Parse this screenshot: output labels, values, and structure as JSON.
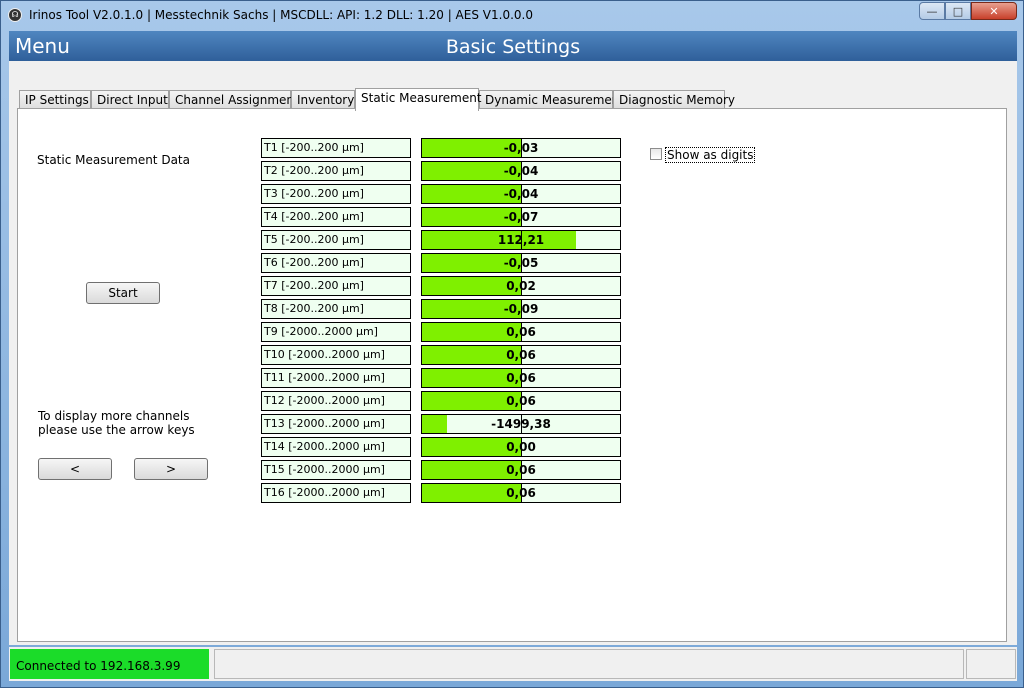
{
  "window": {
    "title": "Irinos Tool V2.0.1.0 | Messtechnik Sachs | MSCDLL: API: 1.2 DLL: 1.20 | AES V1.0.0.0",
    "buttons": {
      "minimize": "—",
      "maximize": "□",
      "close": "✕"
    }
  },
  "header": {
    "menu": "Menu",
    "title": "Basic Settings"
  },
  "tabs": [
    {
      "label": "IP Settings"
    },
    {
      "label": "Direct Input"
    },
    {
      "label": "Channel Assignment"
    },
    {
      "label": "Inventory"
    },
    {
      "label": "Static Measurement"
    },
    {
      "label": "Dynamic Measurement"
    },
    {
      "label": "Diagnostic Memory"
    }
  ],
  "static": {
    "data_label": "Static Measurement Data",
    "start_button": "Start",
    "hint_line1": "To display more channels",
    "hint_line2": "please use the arrow keys",
    "prev_button": "<",
    "next_button": ">",
    "show_digits_label": "Show as digits",
    "show_digits_checked": false
  },
  "channels": [
    {
      "label": "T1 [-200..200 µm]",
      "value": "-0,03",
      "fill_start": 0,
      "fill_end": 0.5
    },
    {
      "label": "T2 [-200..200 µm]",
      "value": "-0,04",
      "fill_start": 0,
      "fill_end": 0.5
    },
    {
      "label": "T3 [-200..200 µm]",
      "value": "-0,04",
      "fill_start": 0,
      "fill_end": 0.5
    },
    {
      "label": "T4 [-200..200 µm]",
      "value": "-0,07",
      "fill_start": 0,
      "fill_end": 0.5
    },
    {
      "label": "T5 [-200..200 µm]",
      "value": "112,21",
      "fill_start": 0,
      "fill_end": 0.78
    },
    {
      "label": "T6 [-200..200 µm]",
      "value": "-0,05",
      "fill_start": 0,
      "fill_end": 0.5
    },
    {
      "label": "T7 [-200..200 µm]",
      "value": "0,02",
      "fill_start": 0,
      "fill_end": 0.5
    },
    {
      "label": "T8 [-200..200 µm]",
      "value": "-0,09",
      "fill_start": 0,
      "fill_end": 0.5
    },
    {
      "label": "T9 [-2000..2000 µm]",
      "value": "0,06",
      "fill_start": 0,
      "fill_end": 0.5
    },
    {
      "label": "T10 [-2000..2000 µm]",
      "value": "0,06",
      "fill_start": 0,
      "fill_end": 0.5
    },
    {
      "label": "T11 [-2000..2000 µm]",
      "value": "0,06",
      "fill_start": 0,
      "fill_end": 0.5
    },
    {
      "label": "T12 [-2000..2000 µm]",
      "value": "0,06",
      "fill_start": 0,
      "fill_end": 0.5
    },
    {
      "label": "T13 [-2000..2000 µm]",
      "value": "-1499,38",
      "fill_start": 0,
      "fill_end": 0.125
    },
    {
      "label": "T14 [-2000..2000 µm]",
      "value": "0,00",
      "fill_start": 0,
      "fill_end": 0.5
    },
    {
      "label": "T15 [-2000..2000 µm]",
      "value": "0,06",
      "fill_start": 0,
      "fill_end": 0.5
    },
    {
      "label": "T16 [-2000..2000 µm]",
      "value": "0,06",
      "fill_start": 0,
      "fill_end": 0.5
    }
  ],
  "status": {
    "connection": "Connected to 192.168.3.99",
    "connection_color": "#1bdc29"
  }
}
